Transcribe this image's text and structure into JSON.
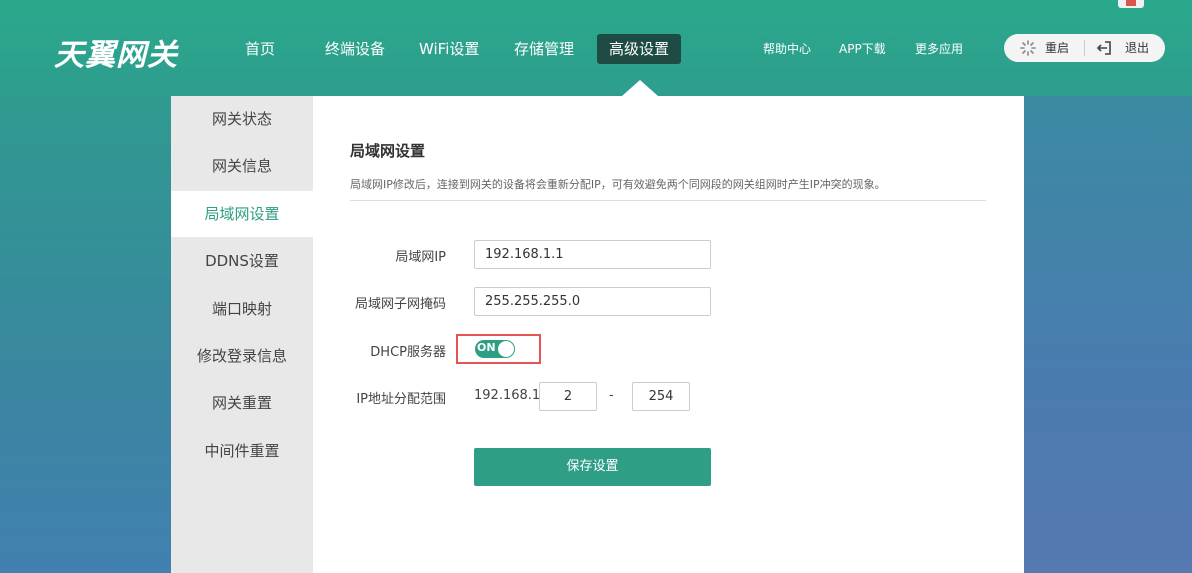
{
  "brand": {
    "logo_text": "天翼网关"
  },
  "nav": {
    "items": [
      {
        "label": "首页"
      },
      {
        "label": "终端设备"
      },
      {
        "label": "WiFi设置"
      },
      {
        "label": "存储管理"
      },
      {
        "label": "高级设置",
        "active": true
      }
    ]
  },
  "top_links": {
    "help": "帮助中心",
    "app": "APP下载",
    "more": "更多应用"
  },
  "actions": {
    "restart": "重启",
    "logout": "退出"
  },
  "sidebar": {
    "items": [
      {
        "label": "网关状态"
      },
      {
        "label": "网关信息"
      },
      {
        "label": "局域网设置",
        "active": true
      },
      {
        "label": "DDNS设置"
      },
      {
        "label": "端口映射"
      },
      {
        "label": "修改登录信息"
      },
      {
        "label": "网关重置"
      },
      {
        "label": "中间件重置"
      }
    ]
  },
  "lan": {
    "title": "局域网设置",
    "description": "局域网IP修改后，连接到网关的设备将会重新分配IP，可有效避免两个同网段的网关组网时产生IP冲突的现象。",
    "ip_label": "局域网IP",
    "ip_value": "192.168.1.1",
    "mask_label": "局域网子网掩码",
    "mask_value": "255.255.255.0",
    "dhcp_label": "DHCP服务器",
    "dhcp_state": "ON",
    "range_label": "IP地址分配范围",
    "range_prefix": "192.168.1.",
    "range_start": "2",
    "range_separator": "-",
    "range_end": "254",
    "save_label": "保存设置"
  },
  "colors": {
    "accent": "#2e9e85",
    "active_nav": "#1e4c44",
    "highlight": "#e55353"
  }
}
